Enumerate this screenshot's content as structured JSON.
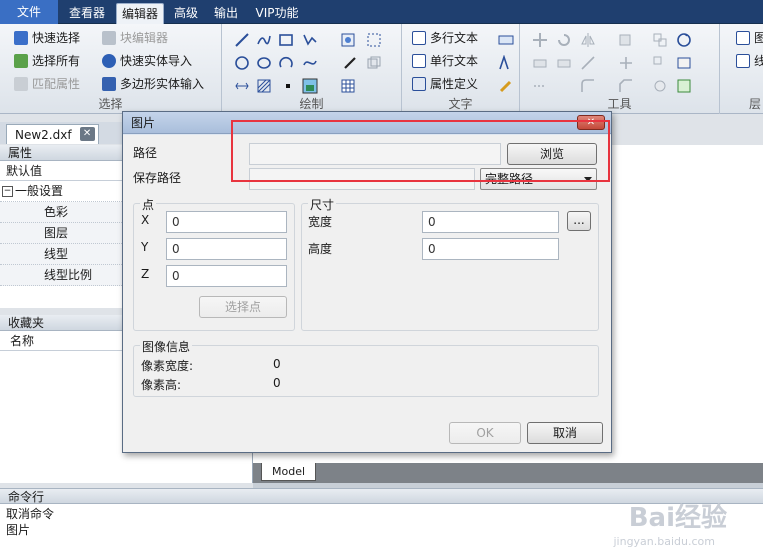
{
  "menu": {
    "tabs": [
      "文件",
      "查看器",
      "编辑器",
      "高级",
      "输出",
      "VIP功能"
    ],
    "active_index": 2
  },
  "ribbon": {
    "select_group": {
      "label": "选择",
      "buttons": [
        "快速选择",
        "块编辑器",
        "选择所有",
        "快速实体导入",
        "匹配属性",
        "多边形实体输入"
      ]
    },
    "draw_group": {
      "label": "绘制"
    },
    "text_group": {
      "label": "文字",
      "buttons": [
        "多行文本",
        "单行文本",
        "属性定义"
      ]
    },
    "tools_group": {
      "label": "工具"
    },
    "layer_group": {
      "label": "层",
      "buttons": [
        "图",
        "线"
      ]
    }
  },
  "document_tab": {
    "name": "New2.dxf"
  },
  "properties_panel": {
    "title": "属性",
    "combo_value": "默认值",
    "group": "一般设置",
    "items": [
      "色彩",
      "图层",
      "线型",
      "线型比例"
    ]
  },
  "favorites_panel": {
    "title": "收藏夹",
    "column": "名称"
  },
  "model_tab": "Model",
  "command_line": {
    "title": "命令行",
    "lines": [
      "取消命令",
      "图片"
    ]
  },
  "dialog": {
    "title": "图片",
    "path_label": "路径",
    "path_value": "",
    "browse_label": "浏览",
    "save_path_label": "保存路径",
    "save_path_value": "",
    "save_path_mode": "完整路径",
    "point_group": {
      "label": "点",
      "x_label": "X",
      "x_value": "0",
      "y_label": "Y",
      "y_value": "0",
      "z_label": "Z",
      "z_value": "0",
      "select_point_label": "选择点"
    },
    "size_group": {
      "label": "尺寸",
      "width_label": "宽度",
      "width_value": "0",
      "height_label": "高度",
      "height_value": "0",
      "more_label": "..."
    },
    "image_info": {
      "label": "图像信息",
      "pixel_width_label": "像素宽度:",
      "pixel_width_value": "0",
      "pixel_height_label": "像素高:",
      "pixel_height_value": "0"
    },
    "ok_label": "OK",
    "cancel_label": "取消"
  },
  "watermark": {
    "brand": "Bai经验",
    "url": "jingyan.baidu.com"
  },
  "colors": {
    "menubar": "#1f3f6f",
    "highlight_box": "#e8343f",
    "dialog_title": "#a9bedb"
  }
}
